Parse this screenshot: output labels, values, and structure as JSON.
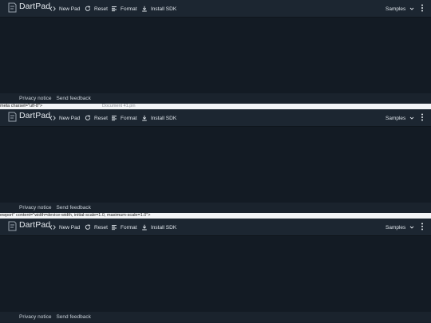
{
  "app": {
    "title": "DartPad",
    "toolbar": {
      "new_pad": "New Pad",
      "reset": "Reset",
      "format": "Format",
      "install_sdk": "Install SDK",
      "samples": "Samples"
    },
    "footer": {
      "privacy": "Privacy notice",
      "feedback": "Send feedback"
    }
  },
  "strips": {
    "first_code": "meta charset=\"utf-8\">",
    "first_doc": "Document 41.pin",
    "second_code": "ewport\" content=\"width=device-width, initial-scale=1.0, maximum-scale=1.0\">"
  },
  "colors": {
    "background": "#17202b",
    "appbar": "#1c2631",
    "editor": "#131b24",
    "footer": "#1a232d",
    "strip": "#f3f5f7"
  },
  "icons": [
    "dartpad-logo-icon",
    "code-icon",
    "refresh-icon",
    "format-icon",
    "download-icon",
    "chevron-down-icon",
    "more-vert-icon"
  ]
}
